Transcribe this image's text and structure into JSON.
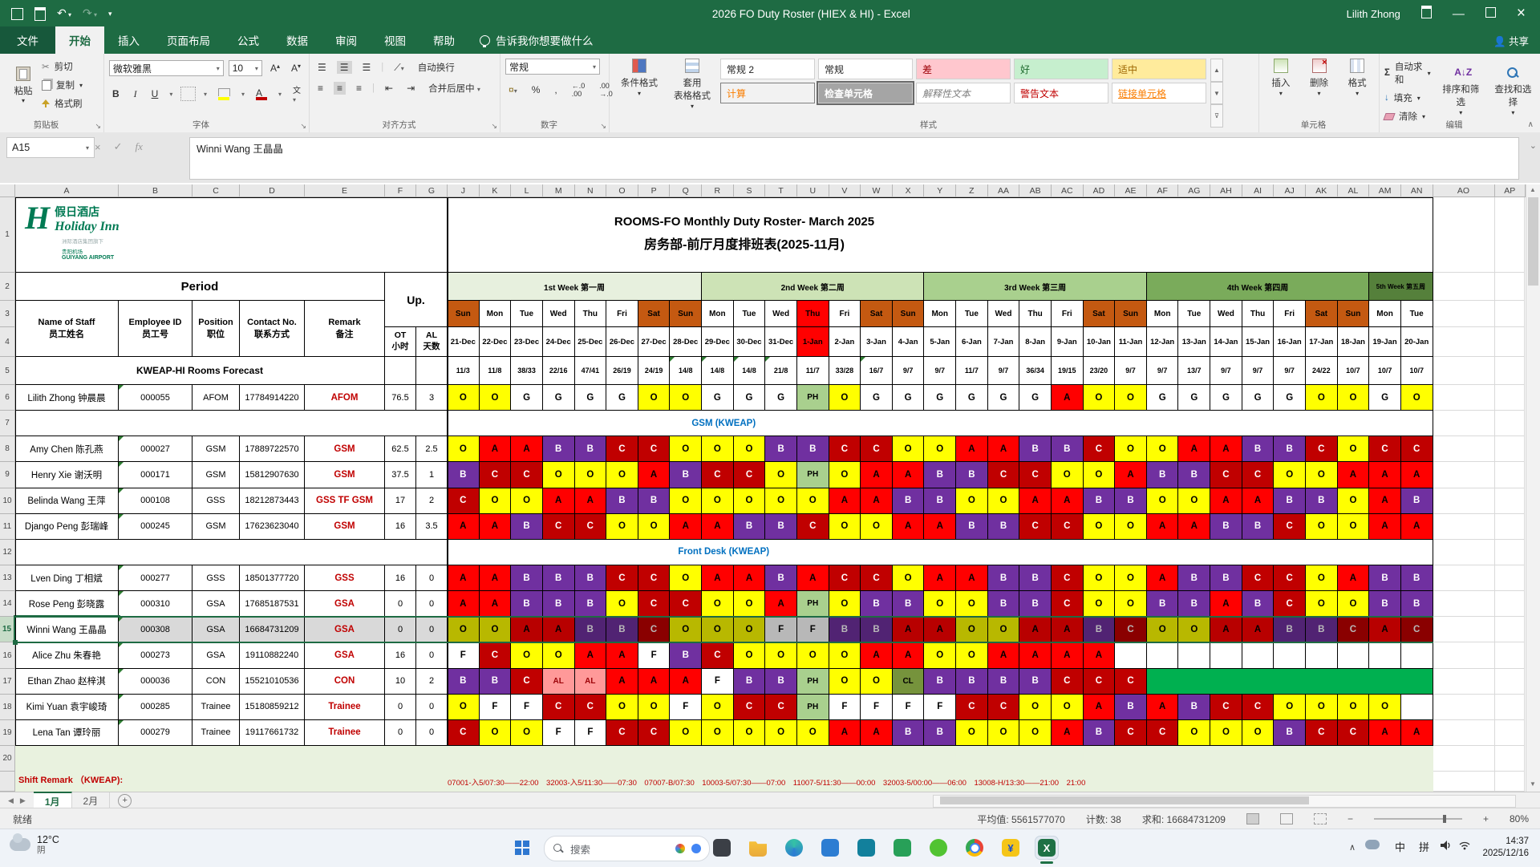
{
  "window": {
    "title": "2026 FO Duty Roster (HIEX & HI)  -  Excel",
    "user": "Lilith Zhong"
  },
  "icons": {
    "dropdown": "▾",
    "undo": "↶",
    "redo": "↷",
    "scissors": "✂",
    "sigma": "Σ",
    "minimize": "—",
    "close": "×",
    "left": "◀",
    "right": "▶",
    "up": "▲",
    "down": "▼",
    "check": "✓",
    "x": "×",
    "fx": "fx",
    "chevron_up": "∧",
    "launcher": "↘"
  },
  "ribbon": {
    "tabs": [
      "文件",
      "开始",
      "插入",
      "页面布局",
      "公式",
      "数据",
      "审阅",
      "视图",
      "帮助"
    ],
    "active_tab": "开始",
    "tell_me": "告诉我你想要做什么",
    "share": "共享",
    "groups": {
      "clipboard": {
        "label": "剪贴板",
        "paste": "粘贴",
        "cut": "剪切",
        "copy": "复制",
        "painter": "格式刷"
      },
      "font": {
        "label": "字体",
        "family": "微软雅黑",
        "size": "10",
        "phonetic": "文"
      },
      "alignment": {
        "label": "对齐方式",
        "wrap": "自动换行",
        "merge": "合并后居中"
      },
      "number": {
        "label": "数字",
        "format": "常规"
      },
      "styles": {
        "label": "样式",
        "conditional": "条件格式",
        "format_table": "套用\n表格格式",
        "gallery": [
          {
            "t": "常规 2",
            "bg": "#FFFFFF",
            "fg": "#222222"
          },
          {
            "t": "常规",
            "bg": "#FFFFFF",
            "fg": "#222222"
          },
          {
            "t": "差",
            "bg": "#FFC7CE",
            "fg": "#9C0006"
          },
          {
            "t": "好",
            "bg": "#C6EFCE",
            "fg": "#1E6B2E"
          },
          {
            "t": "适中",
            "bg": "#FFEB9C",
            "fg": "#9C6500"
          },
          {
            "t": "计算",
            "bg": "#F2F2F2",
            "fg": "#FA7D00",
            "bd": "#7F7F7F"
          },
          {
            "t": "检查单元格",
            "bg": "#A5A5A5",
            "fg": "#FFFFFF",
            "bold": true,
            "sel": true
          },
          {
            "t": "解释性文本",
            "bg": "#FFFFFF",
            "fg": "#7F7F7F",
            "italic": true
          },
          {
            "t": "警告文本",
            "bg": "#FFFFFF",
            "fg": "#C00000"
          },
          {
            "t": "链接单元格",
            "bg": "#FFFFFF",
            "fg": "#FA7D00",
            "ul": true
          }
        ]
      },
      "cells": {
        "label": "单元格",
        "insert": "插入",
        "del": "删除",
        "format": "格式"
      },
      "editing": {
        "label": "编辑",
        "autosum": "自动求和",
        "fill": "填充",
        "clear": "清除",
        "sort": "排序和筛选",
        "find": "查找和选择"
      }
    }
  },
  "formula_bar": {
    "name_box": "A15",
    "value": "Winni Wang 王晶晶"
  },
  "sheet": {
    "col_letters_left": [
      "A",
      "B",
      "C",
      "D",
      "E",
      "F",
      "G"
    ],
    "col_letters_days": [
      "J",
      "K",
      "L",
      "M",
      "N",
      "O",
      "P",
      "Q",
      "R",
      "S",
      "T",
      "U",
      "V",
      "W",
      "X",
      "Y",
      "Z",
      "AA",
      "AB",
      "AC",
      "AD",
      "AE",
      "AF",
      "AG",
      "AH",
      "AI",
      "AJ",
      "AK",
      "AL",
      "AM",
      "AN"
    ],
    "col_letters_right": [
      "AO",
      "AP"
    ],
    "logo": {
      "cn": "假日酒店",
      "en": "Holiday Inn",
      "sub1": "洲际酒店集团旗下",
      "sub2": "贵阳机场",
      "sub3": "GUIYANG AIRPORT"
    },
    "title1": "ROOMS-FO Monthly Duty Roster- March 2025",
    "title2": "房务部-前厅月度排班表(2025-11月)",
    "period": "Period",
    "up": "Up.",
    "left_headers": [
      [
        "Name of Staff",
        "员工姓名"
      ],
      [
        "Employee ID",
        "员工号"
      ],
      [
        "Position",
        "职位"
      ],
      [
        "Contact No.",
        "联系方式"
      ],
      [
        "Remark",
        "备注"
      ]
    ],
    "ot_header": [
      "OT",
      "小时"
    ],
    "al_header": [
      "AL",
      "天数"
    ],
    "weeks": [
      {
        "label": "1st Week 第一周",
        "span": 8,
        "bg": "#E7F0DE"
      },
      {
        "label": "2nd Week 第二周",
        "span": 7,
        "bg": "#CDE3B6"
      },
      {
        "label": "3rd Week 第三周",
        "span": 7,
        "bg": "#A9D08E"
      },
      {
        "label": "4th Week 第四周",
        "span": 7,
        "bg": "#7AAB5B"
      },
      {
        "label": "5th Week 第五周",
        "span": 2,
        "bg": "#55803B"
      }
    ],
    "days": [
      "Sun",
      "Mon",
      "Tue",
      "Wed",
      "Thu",
      "Fri",
      "Sat",
      "Sun",
      "Mon",
      "Tue",
      "Wed",
      "Thu",
      "Fri",
      "Sat",
      "Sun",
      "Mon",
      "Tue",
      "Wed",
      "Thu",
      "Fri",
      "Sat",
      "Sun",
      "Mon",
      "Tue",
      "Wed",
      "Thu",
      "Fri",
      "Sat",
      "Sun",
      "Mon",
      "Tue"
    ],
    "dates": [
      "21-Dec",
      "22-Dec",
      "23-Dec",
      "24-Dec",
      "25-Dec",
      "26-Dec",
      "27-Dec",
      "28-Dec",
      "29-Dec",
      "30-Dec",
      "31-Dec",
      "1-Jan",
      "2-Jan",
      "3-Jan",
      "4-Jan",
      "5-Jan",
      "6-Jan",
      "7-Jan",
      "8-Jan",
      "9-Jan",
      "10-Jan",
      "11-Jan",
      "12-Jan",
      "13-Jan",
      "14-Jan",
      "15-Jan",
      "16-Jan",
      "17-Jan",
      "18-Jan",
      "19-Jan",
      "20-Jan"
    ],
    "weekend_cols": [
      0,
      6,
      7,
      13,
      14,
      20,
      21,
      27,
      28
    ],
    "holiday_cols": [
      11
    ],
    "forecast_label": "KWEAP-HI Rooms Forecast",
    "forecast": [
      "11/3",
      "11/8",
      "38/33",
      "22/16",
      "47/41",
      "26/19",
      "24/19",
      "14/8",
      "14/8",
      "14/8",
      "21/8",
      "11/7",
      "33/28",
      "16/7",
      "9/7",
      "9/7",
      "11/7",
      "9/7",
      "36/34",
      "19/15",
      "23/20",
      "9/7",
      "9/7",
      "13/7",
      "9/7",
      "9/7",
      "9/7",
      "24/22",
      "10/7",
      "10/7",
      "10/7"
    ],
    "forecast_notes": [
      7,
      8,
      9,
      10,
      13
    ],
    "shift_styles": {
      "O": [
        "#FFFF00",
        "#000000"
      ],
      "A": [
        "#FF0000",
        "#000000"
      ],
      "B": [
        "#7030A0",
        "#FFFFFF"
      ],
      "C": [
        "#C00000",
        "#FFFFFF"
      ],
      "G": [
        "#FFFFFF",
        "#000000"
      ],
      "F": [
        "#FFFFFF",
        "#000000"
      ],
      "PH": [
        "#A9D08E",
        "#000000"
      ],
      "AL": [
        "#FF9999",
        "#9C0006"
      ],
      "CL": [
        "#76933C",
        "#000000"
      ],
      "": [
        "#FFFFFF",
        "#000000"
      ]
    },
    "roster": [
      {
        "type": "staff",
        "name": "Lilith Zhong 钟晨晨",
        "id": "000055",
        "pos": "AFOM",
        "contact": "17784914220",
        "remark": "AFOM",
        "ot": "76.5",
        "al": "3",
        "shifts": [
          "O",
          "O",
          "G",
          "G",
          "G",
          "G",
          "O",
          "O",
          "G",
          "G",
          "G",
          "PH",
          "O",
          "G",
          "G",
          "G",
          "G",
          "G",
          "G",
          "A",
          "O",
          "O",
          "G",
          "G",
          "G",
          "G",
          "G",
          "O",
          "O",
          "G",
          "O"
        ]
      },
      {
        "type": "section",
        "title": "GSM (KWEAP)"
      },
      {
        "type": "staff",
        "name": "Amy Chen 陈孔燕",
        "id": "000027",
        "pos": "GSM",
        "contact": "17889722570",
        "remark": "GSM",
        "ot": "62.5",
        "al": "2.5",
        "shifts": [
          "O",
          "A",
          "A",
          "B",
          "B",
          "C",
          "C",
          "O",
          "O",
          "O",
          "B",
          "B",
          "C",
          "C",
          "O",
          "O",
          "A",
          "A",
          "B",
          "B",
          "C",
          "O",
          "O",
          "A",
          "A",
          "B",
          "B",
          "C",
          "O",
          "C",
          "C"
        ]
      },
      {
        "type": "staff",
        "name": "Henry Xie 谢沃明",
        "id": "000171",
        "pos": "GSM",
        "contact": "15812907630",
        "remark": "GSM",
        "ot": "37.5",
        "al": "1",
        "shifts": [
          "B",
          "C",
          "C",
          "O",
          "O",
          "O",
          "A",
          "B",
          "C",
          "C",
          "O",
          "PH",
          "O",
          "A",
          "A",
          "B",
          "B",
          "C",
          "C",
          "O",
          "O",
          "A",
          "B",
          "B",
          "C",
          "C",
          "O",
          "O",
          "A",
          "A",
          "A"
        ]
      },
      {
        "type": "staff",
        "name": "Belinda Wang 王萍",
        "id": "000108",
        "pos": "GSS",
        "contact": "18212873443",
        "remark": "GSS TF GSM",
        "ot": "17",
        "al": "2",
        "shifts": [
          "C",
          "O",
          "O",
          "A",
          "A",
          "B",
          "B",
          "O",
          "O",
          "O",
          "O",
          "O",
          "A",
          "A",
          "B",
          "B",
          "O",
          "O",
          "A",
          "A",
          "B",
          "B",
          "O",
          "O",
          "A",
          "A",
          "B",
          "B",
          "O",
          "A",
          "B"
        ]
      },
      {
        "type": "staff",
        "name": "Django Peng 彭瑞峰",
        "id": "000245",
        "pos": "GSM",
        "contact": "17623623040",
        "remark": "GSM",
        "ot": "16",
        "al": "3.5",
        "shifts": [
          "A",
          "A",
          "B",
          "C",
          "C",
          "O",
          "O",
          "A",
          "A",
          "B",
          "B",
          "C",
          "O",
          "O",
          "A",
          "A",
          "B",
          "B",
          "C",
          "C",
          "O",
          "O",
          "A",
          "A",
          "B",
          "B",
          "C",
          "O",
          "O",
          "A",
          "A"
        ]
      },
      {
        "type": "section",
        "title": "Front Desk (KWEAP)"
      },
      {
        "type": "staff",
        "name": "Lven Ding 丁相斌",
        "id": "000277",
        "pos": "GSS",
        "contact": "18501377720",
        "remark": "GSS",
        "ot": "16",
        "al": "0",
        "shifts": [
          "A",
          "A",
          "B",
          "B",
          "B",
          "C",
          "C",
          "O",
          "A",
          "A",
          "B",
          "A",
          "C",
          "C",
          "O",
          "A",
          "A",
          "B",
          "B",
          "C",
          "O",
          "O",
          "A",
          "B",
          "B",
          "C",
          "C",
          "O",
          "A",
          "B",
          "B"
        ]
      },
      {
        "type": "staff",
        "name": "Rose Peng 彭晓露",
        "id": "000310",
        "pos": "GSA",
        "contact": "17685187531",
        "remark": "GSA",
        "ot": "0",
        "al": "0",
        "shifts": [
          "A",
          "A",
          "B",
          "B",
          "B",
          "O",
          "C",
          "C",
          "O",
          "O",
          "A",
          "PH",
          "O",
          "B",
          "B",
          "O",
          "O",
          "B",
          "B",
          "C",
          "O",
          "O",
          "B",
          "B",
          "A",
          "B",
          "C",
          "O",
          "O",
          "B",
          "B"
        ]
      },
      {
        "type": "staff",
        "name": "Winni Wang 王晶晶",
        "id": "000308",
        "pos": "GSA",
        "contact": "16684731209",
        "remark": "GSA",
        "ot": "0",
        "al": "0",
        "selected": true,
        "shifts": [
          "O",
          "O",
          "A",
          "A",
          "B",
          "B",
          "C",
          "O",
          "O",
          "O",
          "F",
          "F",
          "B",
          "B",
          "A",
          "A",
          "O",
          "O",
          "A",
          "A",
          "B",
          "C",
          "O",
          "O",
          "A",
          "A",
          "B",
          "B",
          "C",
          "A",
          "C"
        ]
      },
      {
        "type": "staff",
        "name": "Alice Zhu 朱春艳",
        "id": "000273",
        "pos": "GSA",
        "contact": "19110882240",
        "remark": "GSA",
        "ot": "16",
        "al": "0",
        "shifts": [
          "F",
          "C",
          "O",
          "O",
          "A",
          "A",
          "F",
          "B",
          "C",
          "O",
          "O",
          "O",
          "O",
          "A",
          "A",
          "O",
          "O",
          "A",
          "A",
          "A",
          "A",
          "",
          "",
          "",
          "",
          "",
          "",
          "",
          "",
          "",
          ""
        ]
      },
      {
        "type": "staff",
        "name": "Ethan Zhao 赵梓淇",
        "id": "000036",
        "pos": "CON",
        "contact": "15521010536",
        "remark": "CON",
        "ot": "10",
        "al": "2",
        "green_from": 22,
        "shifts": [
          "B",
          "B",
          "C",
          "AL",
          "AL",
          "A",
          "A",
          "A",
          "F",
          "B",
          "B",
          "PH",
          "O",
          "O",
          "CL",
          "B",
          "B",
          "B",
          "B",
          "C",
          "C",
          "C"
        ]
      },
      {
        "type": "staff",
        "name": "Kimi Yuan 袁宇峻琦",
        "id": "000285",
        "pos": "Trainee",
        "contact": "15180859212",
        "remark": "Trainee",
        "ot": "0",
        "al": "0",
        "shifts": [
          "O",
          "F",
          "F",
          "C",
          "C",
          "O",
          "O",
          "F",
          "O",
          "C",
          "C",
          "PH",
          "F",
          "F",
          "F",
          "F",
          "C",
          "C",
          "O",
          "O",
          "A",
          "B",
          "A",
          "B",
          "C",
          "C",
          "O",
          "O",
          "O",
          "O",
          ""
        ]
      },
      {
        "type": "staff",
        "name": "Lena Tan 谭玲丽",
        "id": "000279",
        "pos": "Trainee",
        "contact": "19117661732",
        "remark": "Trainee",
        "ot": "0",
        "al": "0",
        "shifts": [
          "C",
          "O",
          "O",
          "F",
          "F",
          "C",
          "C",
          "O",
          "O",
          "O",
          "O",
          "O",
          "A",
          "A",
          "B",
          "B",
          "O",
          "O",
          "O",
          "A",
          "B",
          "C",
          "C",
          "O",
          "O",
          "O",
          "B",
          "C",
          "C",
          "A",
          "A"
        ]
      }
    ],
    "green_merge_color": "#00B050",
    "shift_remark_label": "Shift Remark （KWEAP):",
    "shift_remark_detail": "07001-入5/07:30——22:00　32003-入5/11:30——07:30　07007-B/07:30　10003-5/07:30——07:00　11007-5/11:30——00:00　32003-5/00:00——06:00　13008-H/13:30——21:00　21:00"
  },
  "sheet_tabs": {
    "tabs": [
      "1月",
      "2月"
    ],
    "active": "1月",
    "add": "+"
  },
  "status_bar": {
    "ready": "就绪",
    "average": "平均值: 5561577070",
    "count": "计数: 38",
    "sum": "求和: 16684731209",
    "zoom": "80%"
  },
  "taskbar": {
    "weather_temp": "12°C",
    "weather_cond": "阴",
    "search_text": "搜索",
    "apps": [
      "task-view",
      "file-explorer",
      "edge",
      "app-blue",
      "app-teal",
      "app-green-grid",
      "wechat",
      "chrome",
      "finance-app",
      "excel"
    ],
    "ime_a": "中",
    "ime_b": "拼",
    "time": "14:37",
    "date": "2025/12/16"
  }
}
